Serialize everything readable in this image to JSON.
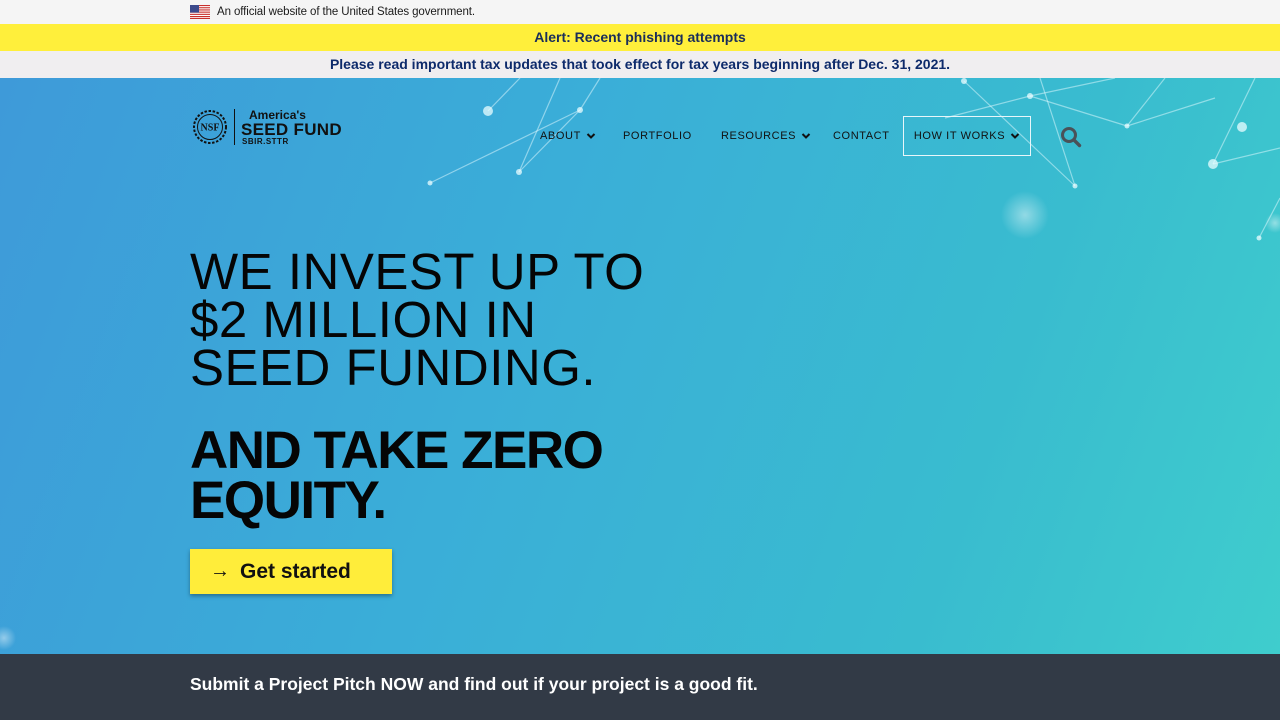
{
  "gov_banner": {
    "flag_icon": "us-flag-icon",
    "text": "An official website of the United States government."
  },
  "alert": {
    "text": "Alert: Recent phishing attempts",
    "background": "#ffef3b"
  },
  "tax_notice": {
    "text": "Please read important tax updates that took effect for tax years beginning after Dec. 31, 2021."
  },
  "logo": {
    "seal_text": "NSF",
    "line1": "America's",
    "line2": "SEED FUND",
    "line3": "SBIR.STTR"
  },
  "nav": {
    "about": "ABOUT",
    "portfolio": "PORTFOLIO",
    "resources": "RESOURCES",
    "contact": "CONTACT",
    "how_it_works": "HOW IT WORKS",
    "search_icon": "search-icon"
  },
  "hero": {
    "headline_lines": [
      "WE INVEST UP TO",
      "$2 MILLION IN",
      "SEED FUNDING."
    ],
    "subhead_lines": [
      "AND TAKE ZERO",
      "EQUITY."
    ],
    "cta_arrow": "→",
    "cta_label": "Get started",
    "cta_color": "#ffed3a"
  },
  "pitch_bar": {
    "text": "Submit a Project Pitch NOW and find out if your project is a good fit.",
    "background": "#323a46"
  }
}
